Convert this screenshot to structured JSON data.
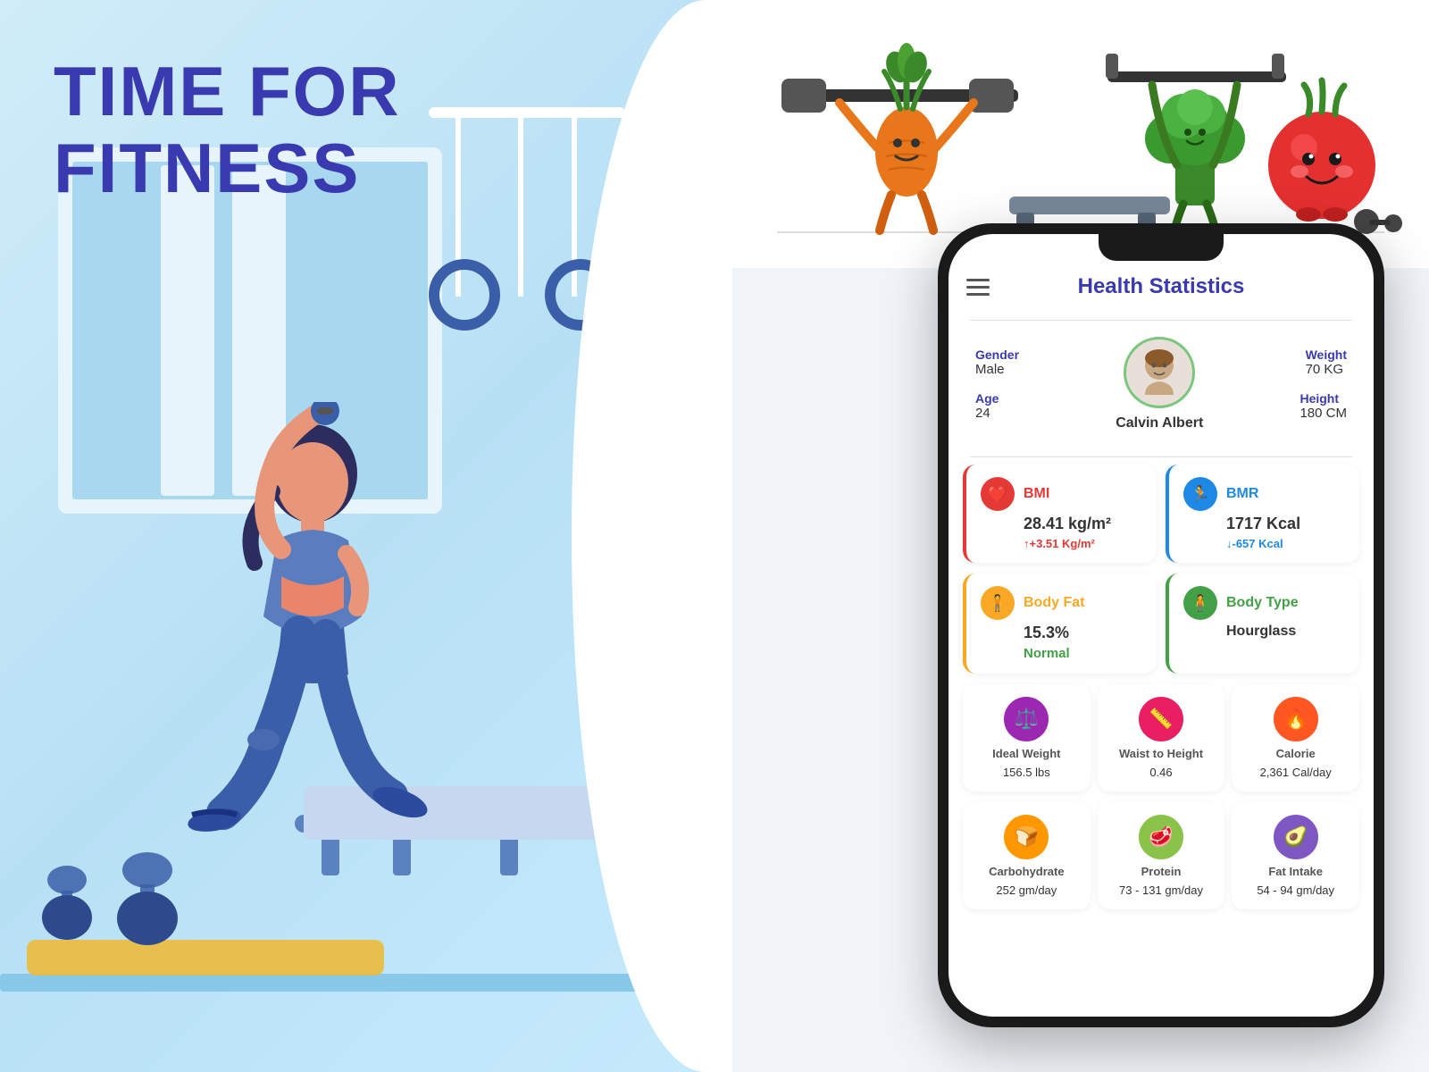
{
  "left": {
    "title_line1": "TIME FOR",
    "title_line2": "FITNESS"
  },
  "right": {
    "app_header": {
      "title": "Health Statistics"
    },
    "profile": {
      "gender_label": "Gender",
      "gender_value": "Male",
      "age_label": "Age",
      "age_value": "24",
      "weight_label": "Weight",
      "weight_value": "70 KG",
      "height_label": "Height",
      "height_value": "180 CM",
      "name": "Calvin Albert"
    },
    "bmi": {
      "title": "BMI",
      "value": "28.41 kg/m²",
      "change": "↑+3.51 Kg/m²"
    },
    "bmr": {
      "title": "BMR",
      "value": "1717 Kcal",
      "change": "↓-657 Kcal"
    },
    "body_fat": {
      "title": "Body Fat",
      "value": "15.3%",
      "sub": "Normal"
    },
    "body_type": {
      "title": "Body Type",
      "value": "Hourglass"
    },
    "ideal_weight": {
      "label": "Ideal Weight",
      "value": "156.5 lbs"
    },
    "waist_height": {
      "label": "Waist to Height",
      "value": "0.46"
    },
    "calorie": {
      "label": "Calorie",
      "value": "2,361 Cal/day"
    },
    "carbohydrate": {
      "label": "Carbohydrate",
      "value": "252 gm/day"
    },
    "protein": {
      "label": "Protein",
      "value": "73 - 131 gm/day"
    },
    "fat_intake": {
      "label": "Fat Intake",
      "value": "54 - 94 gm/day"
    }
  }
}
